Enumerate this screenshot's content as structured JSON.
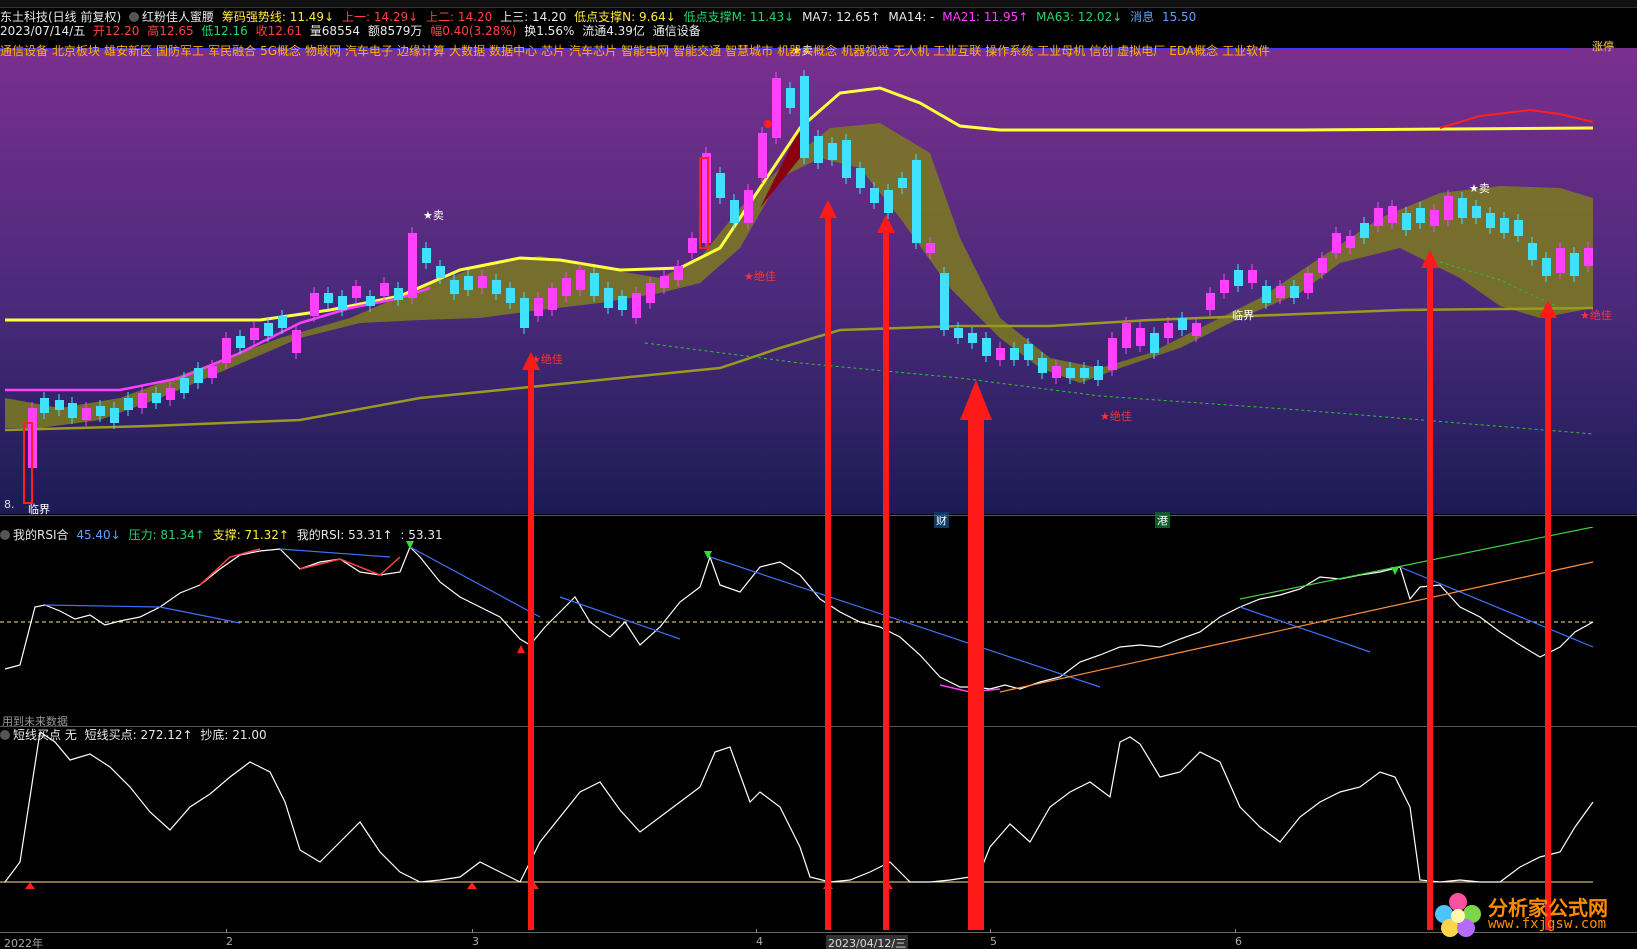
{
  "stock_info": {
    "name": "东土科技(日线 前复权)",
    "indicator_name": "红粉佳人蜜腰",
    "strong_label": "筹码强势线: 11.49↓",
    "up1": "上一: 14.29↓",
    "up2": "上二: 14.20",
    "up3": "上三: 14.20",
    "low_support_n": "低点支撑N: 9.64↓",
    "low_support_m": "低点支撑M: 11.43↓",
    "ma7": "MA7: 12.65↑",
    "ma14": "MA14: -",
    "ma21": "MA21: 11.95↑",
    "ma63": "MA63: 12.02↓",
    "extra1": "消息",
    "extra2": "15.50"
  },
  "quote": {
    "date": "2023/07/14/五",
    "open": "开12.20",
    "high": "高12.65",
    "low": "低12.16",
    "close": "收12.61",
    "volume": "量68554",
    "amount": "额8579万",
    "change": "幅0.40(3.28%)",
    "turnover": "换1.56%",
    "float": "流通4.39亿",
    "sector": "通信设备"
  },
  "sectors": [
    "通信设备",
    "北京板块",
    "雄安新区",
    "国防军工",
    "军民融合",
    "5G概念",
    "物联网",
    "汽车电子",
    "边缘计算",
    "大数据",
    "数据中心",
    "芯片",
    "汽车芯片",
    "智能电网",
    "智能交通",
    "智慧城市",
    "机器人概念",
    "机器视觉",
    "无人机",
    "工业互联",
    "操作系统",
    "工业母机",
    "信创",
    "虚拟电厂",
    "EDA概念",
    "工业软件"
  ],
  "main_annotations": {
    "sell": "★卖",
    "best": "★绝佳",
    "critical": "临界",
    "critical_low": "临界",
    "marker_cai": "财",
    "marker_gang": "港",
    "left_value": "8.",
    "top_right": "涨停"
  },
  "rsi_panel": {
    "title": "我的RSI合",
    "v1": "45.40↓",
    "pressure": "压力: 81.34↑",
    "support": "支撑: 71.32↑",
    "my_rsi": "我的RSI: 53.31↑",
    "v2": ": 53.31",
    "future_note": "用到未来数据"
  },
  "short_panel": {
    "title": "短线买点 无",
    "buy": "短线买点: 272.12↑",
    "bottom": "抄底: 21.00"
  },
  "x_axis": {
    "labels": [
      "2022年",
      "2",
      "3",
      "4",
      "2023/04/12/三",
      "5",
      "6"
    ]
  },
  "watermark": {
    "title": "分析家公式网",
    "url": "www.fxjgsw.com"
  },
  "colors": {
    "background": "#000000",
    "main_gradient_top": "#7a2f8e",
    "main_gradient_bottom": "#1a1a5e",
    "cloud": "#7d7a20",
    "ma_yellow": "#ffff40",
    "ma_magenta": "#ff40ff",
    "up_candle": "#ff40ff",
    "down_candle": "#40e0ff",
    "arrow_red": "#ff1a1a"
  }
}
